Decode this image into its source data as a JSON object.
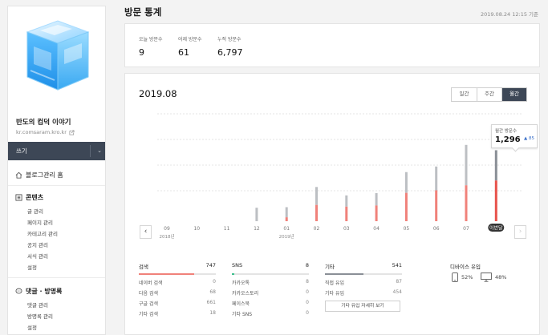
{
  "sidebar": {
    "blog_title": "반도의 컴덕 이야기",
    "blog_url": "kr.comsaram.kro.kr",
    "write_label": "쓰기",
    "home_label": "블로그관리 홈",
    "sections": [
      {
        "title": "콘텐츠",
        "items": [
          "글 관리",
          "페이지 관리",
          "카테고리 관리",
          "공지 관리",
          "서식 관리",
          "설정"
        ]
      },
      {
        "title": "댓글 · 방명록",
        "items": [
          "댓글 관리",
          "방명록 관리",
          "설정"
        ]
      }
    ]
  },
  "header": {
    "title": "방문 통계",
    "timestamp": "2019.08.24 12:15 기준"
  },
  "summary": [
    {
      "label": "오늘 방문수",
      "value": "9"
    },
    {
      "label": "어제 방문수",
      "value": "61"
    },
    {
      "label": "누적 방문수",
      "value": "6,797"
    }
  ],
  "chart_panel": {
    "period": "2019.08",
    "tabs": [
      "일간",
      "주간",
      "월간"
    ],
    "active_tab": "월간",
    "tooltip": {
      "label": "월간 방문수",
      "value": "1,296",
      "delta": "85",
      "delta_arrow": "▲"
    },
    "prev_label": "‹",
    "next_label": "›"
  },
  "chart_data": {
    "type": "bar",
    "categories": [
      "09",
      "10",
      "11",
      "12",
      "01",
      "02",
      "03",
      "04",
      "05",
      "06",
      "07",
      "이번달"
    ],
    "year_labels": [
      {
        "text": "2018년",
        "index": 0
      },
      {
        "text": "2019년",
        "index": 4
      }
    ],
    "series": [
      {
        "name": "",
        "values": [
          0,
          0,
          0,
          48,
          50,
          122,
          92,
          100,
          175,
          195,
          272,
          253
        ],
        "color": "#bcbfc3"
      },
      {
        "name": "",
        "values": [
          0,
          0,
          0,
          0,
          14,
          58,
          52,
          56,
          101,
          110,
          128,
          145
        ],
        "color": "#f0817a"
      }
    ],
    "current_color": "#e8524b",
    "current_upper_color": "#8a8f96",
    "title": "",
    "xlabel": "",
    "ylabel": ""
  },
  "breakdown": [
    {
      "title": "검색",
      "count": "747",
      "fill": 0.72,
      "color": "#f0817a",
      "rows": [
        {
          "name": "네이버 검색",
          "n": "0"
        },
        {
          "name": "다음 검색",
          "n": "68"
        },
        {
          "name": "구글 검색",
          "n": "661"
        },
        {
          "name": "기타 검색",
          "n": "18"
        }
      ]
    },
    {
      "title": "SNS",
      "count": "8",
      "fill": 0.03,
      "color": "#3fbf8e",
      "rows": [
        {
          "name": "카카오톡",
          "n": "8"
        },
        {
          "name": "카카오스토리",
          "n": "0"
        },
        {
          "name": "페이스북",
          "n": "0"
        },
        {
          "name": "기타 SNS",
          "n": "0"
        }
      ]
    },
    {
      "title": "기타",
      "count": "541",
      "fill": 0.5,
      "color": "#8a8f96",
      "rows": [
        {
          "name": "직접 유입",
          "n": "87"
        },
        {
          "name": "기타 유입",
          "n": "454"
        }
      ]
    }
  ],
  "detail_button": "기타 유입 자세히 보기",
  "devices": {
    "title": "디바이스 유입",
    "mobile": "52%",
    "pc": "48%"
  }
}
